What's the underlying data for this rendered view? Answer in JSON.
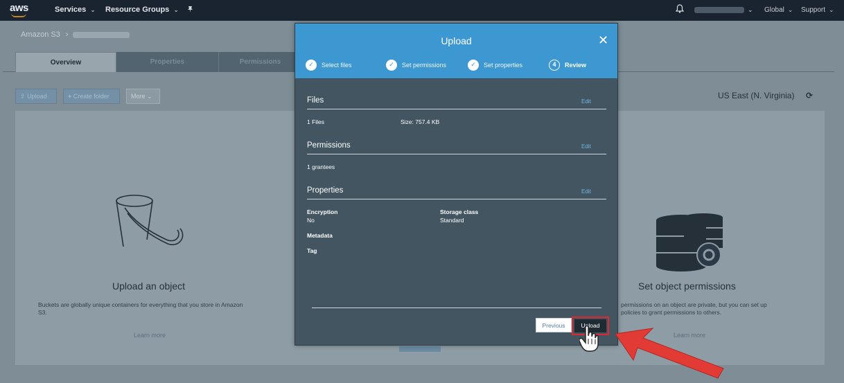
{
  "topnav": {
    "logo": "aws",
    "services": "Services",
    "resource_groups": "Resource Groups",
    "global": "Global",
    "support": "Support",
    "caret": "⌄"
  },
  "breadcrumb": {
    "root": "Amazon S3",
    "sep": "›"
  },
  "tabs": [
    {
      "label": "Overview"
    },
    {
      "label": "Properties"
    },
    {
      "label": "Permissions"
    }
  ],
  "toolbar": {
    "upload": "Upload",
    "create_folder": "Create folder",
    "more": "More"
  },
  "region": "US East (N. Virginia)",
  "features": {
    "upload": {
      "title": "Upload an object",
      "desc": "Buckets are globally unique containers for everything that you store in Amazon S3.",
      "link": "Learn more"
    },
    "permissions": {
      "title": "Set object permissions",
      "desc_line1": "permissions on an object are private, but you can set up",
      "desc_line2": "policies to grant permissions to others.",
      "link": "Learn more"
    }
  },
  "modal": {
    "title": "Upload",
    "close": "✕",
    "steps": [
      {
        "label": "Select files",
        "marker": "✓",
        "done": true
      },
      {
        "label": "Set permissions",
        "marker": "✓",
        "done": true
      },
      {
        "label": "Set properties",
        "marker": "✓",
        "done": true
      },
      {
        "label": "Review",
        "marker": "4",
        "done": false
      }
    ],
    "files": {
      "title": "Files",
      "edit": "Edit",
      "count": "1 Files",
      "size": "Size: 757.4 KB"
    },
    "permissions": {
      "title": "Permissions",
      "edit": "Edit",
      "grantees": "1 grantees"
    },
    "properties": {
      "title": "Properties",
      "edit": "Edit",
      "encryption_label": "Encryption",
      "encryption_value": "No",
      "storage_label": "Storage class",
      "storage_value": "Standard",
      "metadata_label": "Metadata",
      "tag_label": "Tag"
    },
    "previous": "Previous",
    "upload": "Upload"
  },
  "colors": {
    "accent": "#3d98d2",
    "highlight": "#e0262e",
    "modal_bg": "#435560"
  },
  "icons": [
    "bell-icon",
    "pin-icon",
    "refresh-icon",
    "bucket-icon",
    "database-gear-icon",
    "hand-cursor-icon"
  ]
}
